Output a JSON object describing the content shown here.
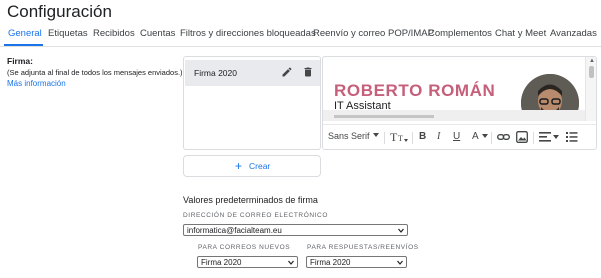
{
  "page": {
    "title": "Configuración"
  },
  "tabs": [
    {
      "label": "General",
      "active": true
    },
    {
      "label": "Etiquetas"
    },
    {
      "label": "Recibidos"
    },
    {
      "label": "Cuentas"
    },
    {
      "label": "Filtros y direcciones bloqueadas"
    },
    {
      "label": "Reenvío y correo POP/IMAP"
    },
    {
      "label": "Complementos"
    },
    {
      "label": "Chat y Meet"
    },
    {
      "label": "Avanzadas"
    }
  ],
  "signature_section": {
    "label": "Firma:",
    "description": "(Se adjunta al final de todos los mensajes enviados.)",
    "more_info_link": "Más información"
  },
  "signature_list": {
    "items": [
      {
        "name": "Firma 2020",
        "selected": true
      }
    ],
    "create_button": {
      "icon": "plus-icon",
      "label": "Crear"
    }
  },
  "signature_editor": {
    "name": "ROBERTO ROMÁN",
    "role": "IT Assistant",
    "name_color": "#c55f7a",
    "toolbar": {
      "font": "Sans Serif",
      "icons": [
        "font-dropdown-icon",
        "text-size-icon",
        "bold-icon",
        "italic-icon",
        "underline-icon",
        "text-color-icon",
        "link-icon",
        "image-icon",
        "align-icon",
        "list-icon"
      ],
      "bold": "B",
      "italic": "I",
      "underline": "U",
      "text_color": "A"
    }
  },
  "defaults": {
    "title": "Valores predeterminados de firma",
    "email_label": "DIRECCIÓN DE CORREO ELECTRÓNICO",
    "email_value": "informatica@facialteam.eu",
    "new_label": "PARA CORREOS NUEVOS",
    "new_value": "Firma 2020",
    "reply_label": "PARA RESPUESTAS/REENVÍOS",
    "reply_value": "Firma 2020"
  },
  "colors": {
    "accent": "#1a73e8",
    "selected_row": "#e8eaed",
    "signature_name": "#c55f7a"
  }
}
